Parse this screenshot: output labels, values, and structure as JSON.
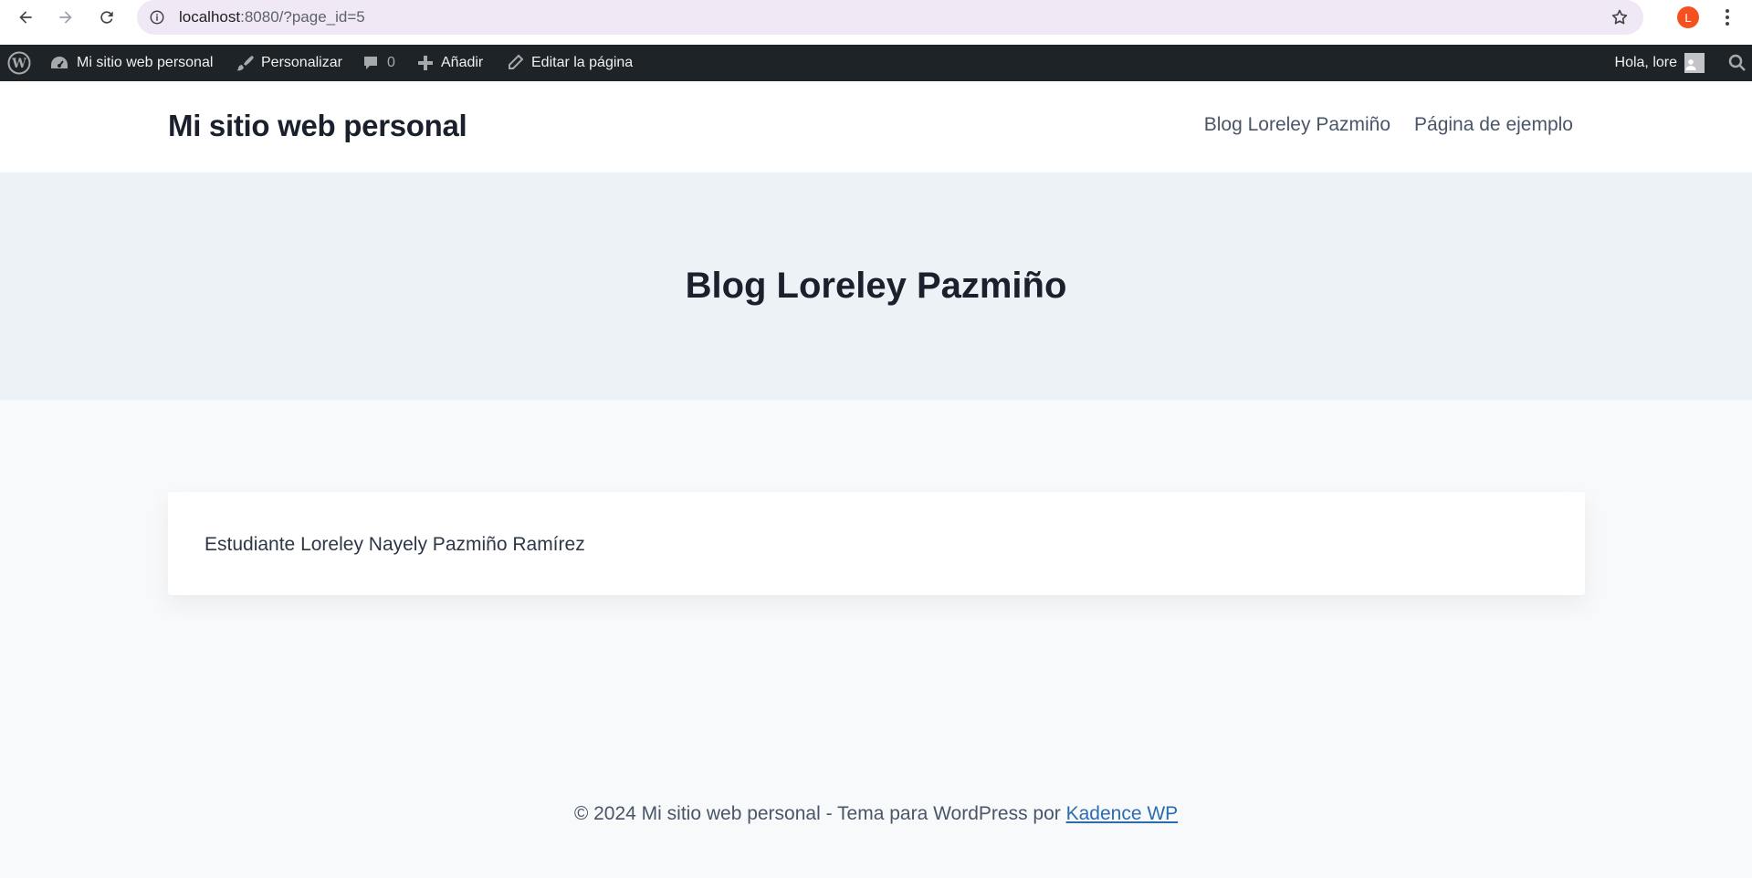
{
  "browser": {
    "url_host": "localhost",
    "url_rest": ":8080/?page_id=5",
    "profile_initial": "L"
  },
  "adminbar": {
    "site_name": "Mi sitio web personal",
    "customize": "Personalizar",
    "comments_count": "0",
    "add_new": "Añadir",
    "edit_page": "Editar la página",
    "greeting": "Hola, lore"
  },
  "header": {
    "site_title": "Mi sitio web personal",
    "nav": [
      {
        "label": "Blog Loreley Pazmiño"
      },
      {
        "label": "Página de ejemplo"
      }
    ]
  },
  "hero": {
    "title": "Blog Loreley Pazmiño"
  },
  "content": {
    "text": "Estudiante Loreley Nayely Pazmiño Ramírez"
  },
  "footer": {
    "text": "© 2024 Mi sitio web personal - Tema para WordPress por ",
    "link": "Kadence WP"
  },
  "colors": {
    "admin_bar": "#1d2327",
    "hero_bg": "#edf2f7",
    "page_bg": "#f7f9fb",
    "link": "#2b6cb0",
    "profile": "#f4511e"
  }
}
